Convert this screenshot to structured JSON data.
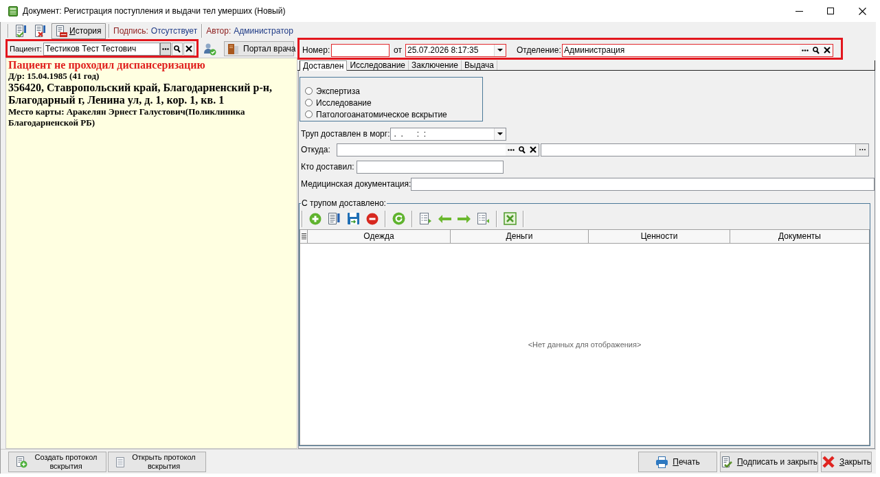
{
  "window": {
    "title": "Документ: Регистрация поступления и выдачи тел умерших (Новый)"
  },
  "toolbar": {
    "history_button": {
      "label": "История",
      "accelerator": true
    },
    "signature": {
      "label": "Подпись:",
      "value": "Отсутствует"
    },
    "author": {
      "label": "Автор:",
      "value": "Администратор"
    }
  },
  "patient": {
    "label": "Пациент:",
    "value": "Тестиков Тест Тестович",
    "highlighted": true
  },
  "portal_button": {
    "label": "Портал врача"
  },
  "patient_info": {
    "warning": "Пациент не проходил диспансеризацию",
    "birth": "Д/р: 15.04.1985 (41 год)",
    "address": "356420, Ставропольский край, Благодарненский р-н, Благодарный г, Ленина ул, д. 1, кор. 1, кв. 1",
    "card_place": "Место карты: Аракелян Эрнест Галустович(Поликлиника Благодарненской РБ)"
  },
  "header": {
    "highlighted": true,
    "number": {
      "label": "Номер:",
      "required": true
    },
    "date": {
      "label": "от",
      "value": "25.07.2026 8:17:35",
      "required": true
    },
    "department": {
      "label": "Отделение:",
      "value": "Администрация",
      "required": true
    }
  },
  "tabs": [
    {
      "label": "Доставлен",
      "selected": true
    },
    {
      "label": "Исследование",
      "selected": false
    },
    {
      "label": "Заключение",
      "selected": false
    },
    {
      "label": "Выдача",
      "selected": false
    }
  ],
  "study_type": {
    "options": [
      {
        "label": "Экспертиза",
        "selected": false
      },
      {
        "label": "Исследование",
        "selected": false
      },
      {
        "label": "Патологоанатомическое вскрытие",
        "selected": false
      }
    ]
  },
  "fields": {
    "delivered_to_morgue": {
      "label": "Труп доставлен в морг:",
      "placeholder": ".  .      :  :"
    },
    "from": {
      "label": "Откуда:"
    },
    "delivered_by": {
      "label": "Кто доставил:"
    },
    "medical_docs": {
      "label": "Медицинская документация:"
    }
  },
  "belongings": {
    "title": "С трупом доставлено:",
    "columns": [
      "Одежда",
      "Деньги",
      "Ценности",
      "Документы"
    ],
    "empty_text": "<Нет данных для отображения>"
  },
  "footer": {
    "left_buttons": [
      {
        "label": "Создать протокол вскрытия",
        "kind": "create"
      },
      {
        "label": "Открыть протокол вскрытия",
        "kind": "open"
      }
    ],
    "right_buttons": [
      {
        "label": "Печать",
        "kind": "print",
        "accelerator": true
      },
      {
        "label": "Подписать и закрыть",
        "kind": "sign",
        "accelerator": true
      },
      {
        "label": "Закрыть",
        "kind": "close",
        "accelerator": true
      }
    ]
  }
}
